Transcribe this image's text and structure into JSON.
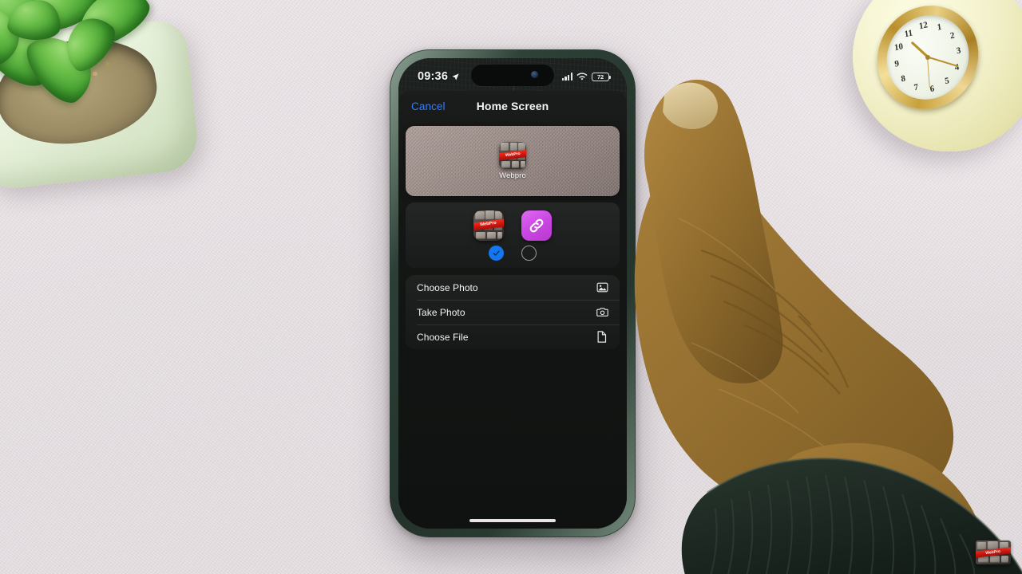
{
  "scene": {
    "description": "Hand holding finger over an iPhone showing the Add to Home Screen sheet",
    "desk_color": "#e7e2e4",
    "objects": {
      "plant": "succulent-plant-in-white-pot",
      "clock": "small-gold-analog-desk-clock",
      "phone": "iphone-alpine-green",
      "hand": "right-hand-pointing-finger",
      "sleeve": "dark-green-ribbed-sleeve-cuff"
    }
  },
  "phone": {
    "frame_color": "#2c3e35",
    "status_bar": {
      "time": "09:36",
      "location_icon": "location-arrow-icon",
      "cellular_icon": "cellular-bars-icon",
      "wifi_icon": "wifi-icon",
      "battery_level": "72",
      "battery_icon": "battery-icon"
    },
    "sheet": {
      "nav": {
        "cancel_label": "Cancel",
        "cancel_color": "#2f7dff",
        "title": "Home Screen"
      },
      "preview": {
        "app_name": "Webpro",
        "icon_name": "webpro-app-icon",
        "icon_badge_text": "WebPro",
        "wallpaper": "grainy-taupe-wallpaper"
      },
      "icon_chooser": {
        "options": [
          {
            "name": "webpro-app-icon",
            "type": "app-icon",
            "badge_text": "WebPro",
            "selected": true,
            "radio_name": "radio-selected"
          },
          {
            "name": "link-icon",
            "type": "link-glyph",
            "color": "#cc4ae4",
            "selected": false,
            "radio_name": "radio-unselected"
          }
        ],
        "selected_color": "#1277f0"
      },
      "actions": [
        {
          "label": "Choose Photo",
          "icon": "photo-icon"
        },
        {
          "label": "Take Photo",
          "icon": "camera-icon"
        },
        {
          "label": "Choose File",
          "icon": "document-icon"
        }
      ]
    },
    "home_indicator": "home-indicator-bar"
  },
  "clock_face": {
    "numerals": [
      "12",
      "1",
      "2",
      "3",
      "4",
      "5",
      "6",
      "7",
      "8",
      "9",
      "10",
      "11"
    ]
  },
  "watermark": {
    "name": "webpro-watermark",
    "badge_text": "WebPro"
  }
}
